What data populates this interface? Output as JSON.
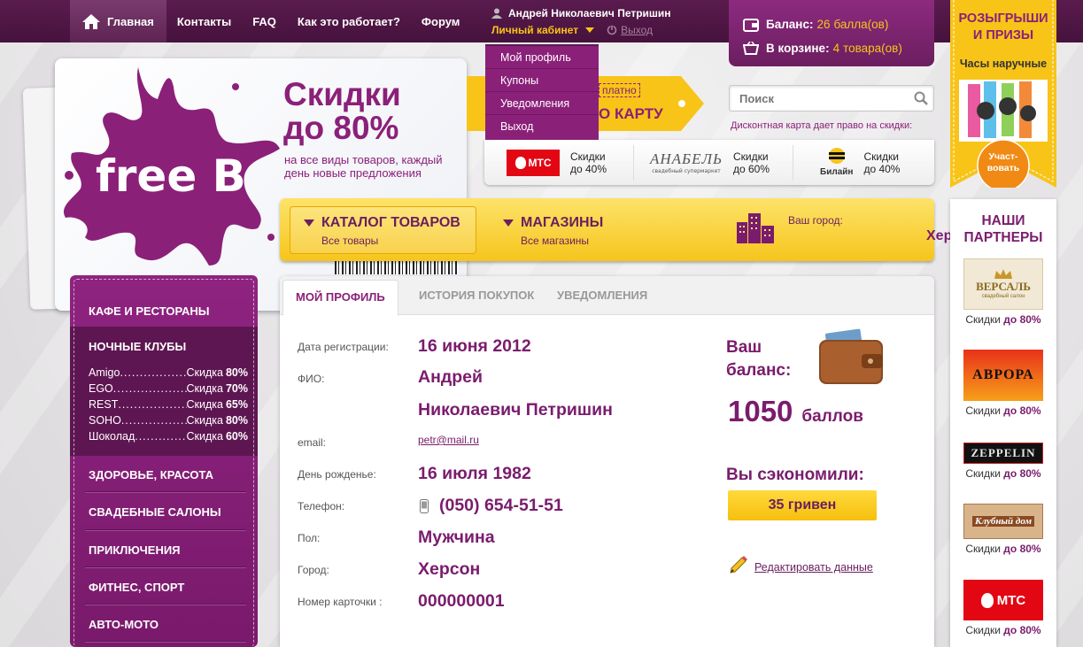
{
  "nav": {
    "home": "Главная",
    "items": [
      "Контакты",
      "FAQ",
      "Как это работает?",
      "Форум"
    ]
  },
  "user": {
    "name": "Андрей Николаевич Петришин",
    "cabinet": "Личный кабинет",
    "logout": "Выход"
  },
  "user_menu": [
    "Мой профиль",
    "Купоны",
    "Уведомления",
    "Выход"
  ],
  "balance": {
    "label": "Баланс:",
    "value": "26",
    "unit": "балла(ов)",
    "cart_label": "В корзине:",
    "cart_value": "4",
    "cart_unit": "товара(ов)"
  },
  "promo": {
    "brand": "free B",
    "title1": "Скидки",
    "title2": "до 80%",
    "subtitle": "на все виды товаров, каждый день новые предложения",
    "tag_top": "платно",
    "tag_bottom": "О КАРТУ"
  },
  "search": {
    "placeholder": "Поиск",
    "note": "Дисконтная карта дает право на скидки:"
  },
  "strip": [
    {
      "logo": "МТС",
      "line1": "Скидки",
      "line2": "до 40%"
    },
    {
      "logo": "АНАБЕЛЬ",
      "sublogo": "свадебный супермаркет",
      "line1": "Скидки",
      "line2": "до 60%"
    },
    {
      "logo": "Билайн",
      "line1": "Скидки",
      "line2": "до 40%"
    }
  ],
  "yellowbar": {
    "catalog": "КАТАЛОГ ТОВАРОВ",
    "catalog_sub": "Все товары",
    "shops": "МАГАЗИНЫ",
    "shops_sub": "Все магазины",
    "city_label": "Ваш город:",
    "city": "Херсон"
  },
  "sidebar": {
    "cats": [
      "КАФЕ И РЕСТОРАНЫ",
      "НОЧНЫЕ КЛУБЫ",
      "ЗДОРОВЬЕ, КРАСОТА",
      "СВАДЕБНЫЕ САЛОНЫ",
      "ПРИКЛЮЧЕНИЯ",
      "ФИТНЕС, СПОРТ",
      "АВТО-МОТО"
    ],
    "clubs": [
      {
        "name": "Amigo",
        "label": "Скидка",
        "pct": "80%"
      },
      {
        "name": "EGO",
        "label": "Скидка",
        "pct": "70%"
      },
      {
        "name": "REST",
        "label": "Скидка",
        "pct": "65%"
      },
      {
        "name": "SOHO",
        "label": "Скидка",
        "pct": "80%"
      },
      {
        "name": "Шоколад",
        "label": "Скидка",
        "pct": "60%"
      }
    ]
  },
  "tabs": [
    "МОЙ ПРОФИЛЬ",
    "ИСТОРИЯ ПОКУПОК",
    "УВЕДОМЛЕНИЯ"
  ],
  "profile": {
    "reg_label": "Дата регистрации:",
    "reg": "16 июня 2012",
    "fio_label": "ФИО:",
    "fio1": "Андрей",
    "fio2": "Николаевич Петришин",
    "email_label": "email:",
    "email": "petr@mail.ru",
    "bday_label": "День рожденье:",
    "bday": "16 июля 1982",
    "phone_label": "Телефон:",
    "phone": "(050) 654-51-51",
    "sex_label": "Пол:",
    "sex": "Мужчина",
    "city_label": "Город:",
    "city": "Херсон",
    "card_label": "Номер карточки :",
    "card": "000000001"
  },
  "account": {
    "bal1": "Ваш",
    "bal2": "баланс:",
    "points": "1050",
    "points_unit": "баллов",
    "saved_label": "Вы сэкономили:",
    "saved": "35 гривен",
    "edit": "Редактировать данные"
  },
  "ribbon": {
    "title1": "РОЗЫГРЫШИ",
    "title2": "И ПРИЗЫ",
    "subtitle": "Часы наручные",
    "btn1": "Участ-",
    "btn2": "вовать"
  },
  "partners": {
    "title1": "НАШИ",
    "title2": "ПАРТНЕРЫ",
    "items": [
      {
        "logo": "ВЕРСАЛЬ",
        "sub": "свадебный салон",
        "label": "Скидки",
        "pct": "до 80%"
      },
      {
        "logo": "АВРОРА",
        "label": "Скидки",
        "pct": "до 80%"
      },
      {
        "logo": "ZEPPELIN",
        "label": "Скидки",
        "pct": "до 80%"
      },
      {
        "logo": "Клубный дом",
        "label": "Скидки",
        "pct": "до 80%"
      },
      {
        "logo": "МТС",
        "label": "Скидки",
        "pct": "до 80%"
      }
    ]
  }
}
